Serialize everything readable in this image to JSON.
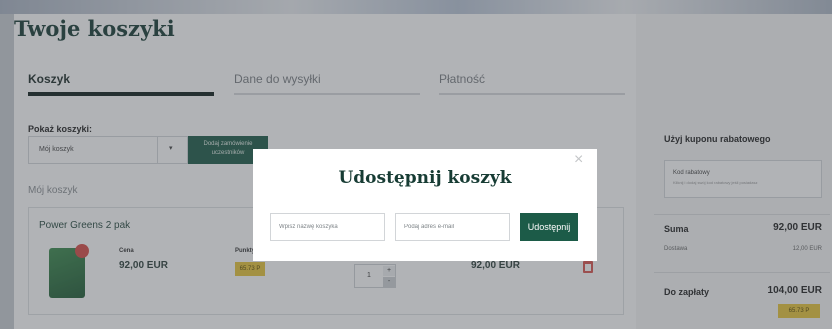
{
  "page": {
    "title": "Twoje koszyki"
  },
  "tabs": [
    {
      "label": "Koszyk",
      "active": true
    },
    {
      "label": "Dane do wysyłki",
      "active": false
    },
    {
      "label": "Płatność",
      "active": false
    }
  ],
  "cart_selector": {
    "label": "Pokaż koszyki:",
    "selected": "Mój koszyk",
    "share_button": "Dodaj zamówienie uczestników"
  },
  "cart": {
    "name": "Mój koszyk",
    "product": {
      "name": "Power Greens 2 pak",
      "price_label": "Cena",
      "price": "92,00 EUR",
      "points_label": "Punkty",
      "points": "65.73 P",
      "quantity": "1",
      "total": "92,00 EUR"
    }
  },
  "sidebar": {
    "coupon_heading": "Użyj kuponu rabatowego",
    "coupon_field_label": "Kod rabatowy",
    "coupon_field_hint": "Kliknij i dodaj swój kod rabatowy jeśli posiadasz",
    "sum_label": "Suma",
    "sum_value": "92,00 EUR",
    "delivery_label": "Dostawa",
    "delivery_value": "12,00 EUR",
    "to_pay_label": "Do zapłaty",
    "to_pay_value": "104,00 EUR",
    "points": "65.73 P"
  },
  "modal": {
    "title": "Udostępnij koszyk",
    "cart_name_placeholder": "Wpisz nazwę koszyka",
    "email_placeholder": "Podaj adres e-mail",
    "submit_label": "Udostępnij"
  },
  "colors": {
    "accent": "#1c5b48",
    "points": "#e7c43a",
    "delete": "#d9534f"
  }
}
